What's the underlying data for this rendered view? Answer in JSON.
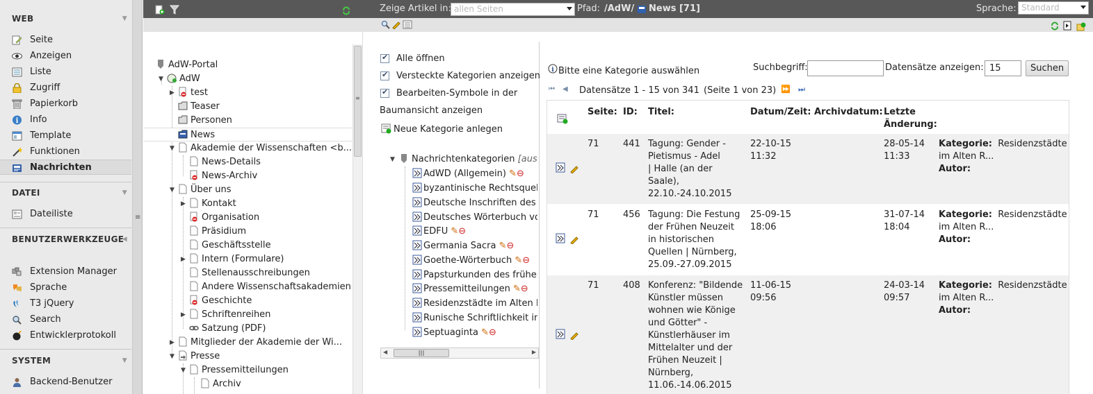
{
  "module_menu": {
    "sections": [
      {
        "title": "WEB",
        "items": [
          "Seite",
          "Anzeigen",
          "Liste",
          "Zugriff",
          "Papierkorb",
          "Info",
          "Template",
          "Funktionen",
          "Nachrichten"
        ]
      },
      {
        "title": "DATEI",
        "items": [
          "Dateiliste"
        ]
      },
      {
        "title": "BENUTZERWERKZEUGE",
        "items": [
          "Extension Manager",
          "Sprache",
          "T3 jQuery",
          "Search",
          "Entwicklerprotokoll"
        ]
      },
      {
        "title": "SYSTEM",
        "items": [
          "Backend-Benutzer"
        ]
      }
    ],
    "active": "Nachrichten"
  },
  "topbar": {
    "show_articles_label": "Zeige Artikel in:",
    "show_articles_value": "allen Seiten",
    "path_label": "Pfad:",
    "path_value": "/AdW/",
    "path_page": "News [71]",
    "language_label": "Sprache:",
    "language_value": "Standard"
  },
  "tree": {
    "nodes": [
      "AdW-Portal",
      "AdW",
      "test",
      "Teaser",
      "Personen",
      "News",
      "Akademie der Wissenschaften <b...",
      "News-Details",
      "News-Archiv",
      "Über uns",
      "Kontakt",
      "Organisation",
      "Präsidium",
      "Geschäftsstelle",
      "Intern (Formulare)",
      "Stellenausschreibungen",
      "Andere Wissenschaftsakademien",
      "Geschichte",
      "Schriftenreihen",
      "Satzung (PDF)",
      "Mitglieder der Akademie der Wi...",
      "Presse",
      "Pressemitteilungen",
      "Archiv"
    ]
  },
  "categories": {
    "options": [
      "Alle öffnen",
      "Versteckte Kategorien anzeigen",
      "Bearbeiten-Symbole in der",
      "Baumansicht anzeigen"
    ],
    "new_category": "Neue Kategorie anlegen",
    "root": "Nachrichtenkategorien",
    "root_suffix": "[aus a",
    "items": [
      "AdWD (Allgemein)",
      "byzantinische Rechtsquelle",
      "Deutsche Inschriften des M",
      "Deutsches Wörterbuch vo",
      "EDFU",
      "Germania Sacra",
      "Goethe-Wörterbuch",
      "Papsturkunden des früher",
      "Pressemitteilungen",
      "Residenzstädte im Alten R",
      "Runische Schriftlichkeit in d",
      "Septuaginta"
    ]
  },
  "list": {
    "hint": "Bitte eine Kategorie auswählen",
    "search_label": "Suchbegriff:",
    "search_value": "",
    "records_label": "Datensätze anzeigen:",
    "records_value": "15",
    "search_button": "Suchen",
    "pager": "Datensätze 1 - 15 von 341",
    "pager_page": "(Seite 1 von 23)",
    "headers": {
      "page": "Seite:",
      "id": "ID:",
      "title": "Titel:",
      "date": "Datum/Zeit:",
      "archive": "Archivdatum:",
      "changed1": "Letzte",
      "changed2": "Änderung:"
    },
    "rows": [
      {
        "page": "71",
        "id": "441",
        "title": [
          "Tagung: Gender -",
          "Pietismus - Adel",
          "| Halle (an der",
          "Saale),",
          "22.10.-24.10.2015"
        ],
        "date": [
          "22-10-15",
          "11:32"
        ],
        "changed": [
          "28-05-14",
          "11:33"
        ],
        "cat_label": "Kategorie:",
        "cat_value": "Residenzstädte",
        "cat_value2": "im Alten R...",
        "author_label": "Autor:"
      },
      {
        "page": "71",
        "id": "456",
        "title": [
          "Tagung: Die Festung",
          "der Frühen Neuzeit",
          "in historischen",
          "Quellen | Nürnberg,",
          "25.09.-27.09.2015"
        ],
        "date": [
          "25-09-15",
          "18:06"
        ],
        "changed": [
          "31-07-14",
          "18:04"
        ],
        "cat_label": "Kategorie:",
        "cat_value": "Residenzstädte",
        "cat_value2": "im Alten R...",
        "author_label": "Autor:"
      },
      {
        "page": "71",
        "id": "408",
        "title": [
          "Konferenz: \"Bildende",
          "Künstler müssen",
          "wohnen wie Könige",
          "und Götter\" -",
          "Künstlerhäuser im",
          "Mittelalter und der",
          "Frühen Neuzeit |",
          "Nürnberg,",
          "11.06.-14.06.2015"
        ],
        "date": [
          "11-06-15",
          "09:56"
        ],
        "changed": [
          "24-03-14",
          "09:57"
        ],
        "cat_label": "Kategorie:",
        "cat_value": "Residenzstädte",
        "cat_value2": "im Alten R...",
        "author_label": "Autor:"
      }
    ]
  }
}
